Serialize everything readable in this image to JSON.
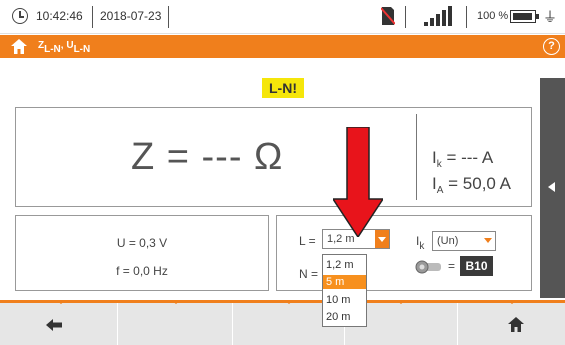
{
  "statusbar": {
    "time": "10:42:46",
    "date": "2018-07-23",
    "battery": "100 %",
    "battery_level": 1.0,
    "icons": [
      "clock-icon",
      "sim-icon",
      "signal-icon",
      "battery-icon",
      "plug-icon"
    ]
  },
  "header": {
    "title": "Z L-N, U L-N",
    "title_z": "Z",
    "title_z_sub": "L-N",
    "title_sep": ", ",
    "title_u": "U",
    "title_u_sub": "L-N",
    "help": "?",
    "accent_color": "#f07f1c"
  },
  "warning": {
    "label": "L-N!",
    "color": "#f5e60a"
  },
  "result": {
    "main": "Z = --- Ω",
    "ik_label": "I",
    "ik_sub": "k",
    "ik_value": " = --- A",
    "ia_label": "I",
    "ia_sub": "A",
    "ia_value": " = 50,0 A"
  },
  "measurements": {
    "u": "U = 0,3 V",
    "f": "f = 0,0 Hz"
  },
  "settings": {
    "l_label": "L =",
    "l_value": "1,2 m",
    "n_label": "N =",
    "ik_label": "I",
    "ik_sub": "k",
    "ik_value": "(Un)",
    "eq": "=",
    "fuse": "B10"
  },
  "dropdown": {
    "options": [
      "1,2 m",
      "5 m",
      "10 m",
      "20 m"
    ],
    "selected": "5 m"
  },
  "navbar": {
    "icons": [
      "back-icon",
      "home-icon"
    ]
  }
}
